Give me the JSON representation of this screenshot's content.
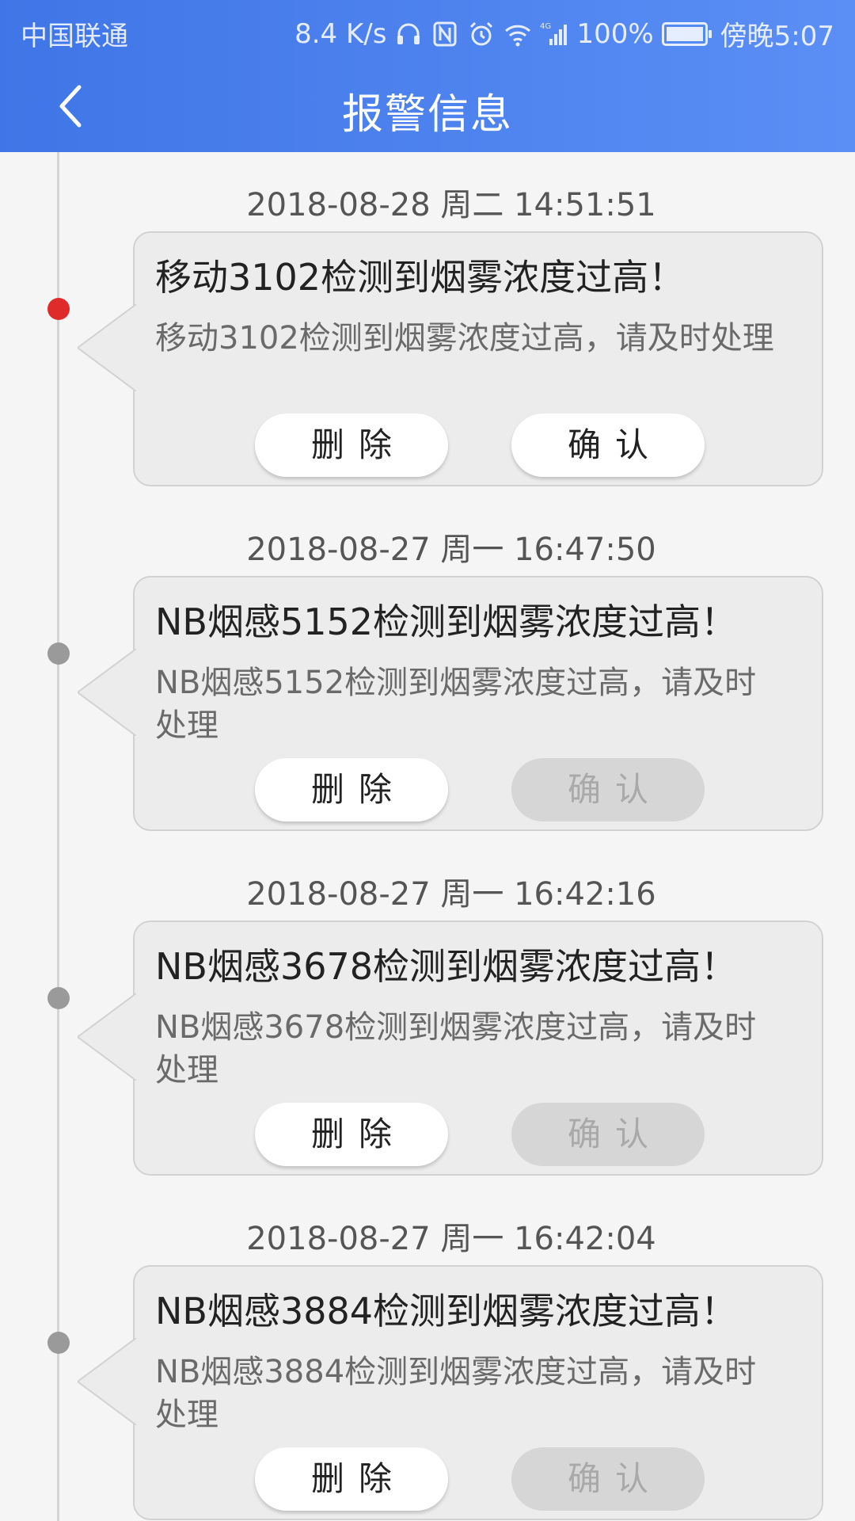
{
  "status_bar": {
    "carrier": "中国联通",
    "network_speed": "8.4 K/s",
    "network_type": "4G",
    "battery": "100%",
    "time": "傍晚5:07",
    "icons": [
      "headset-icon",
      "nfc-icon",
      "alarm-icon",
      "wifi-icon",
      "signal-icon",
      "battery-icon"
    ]
  },
  "header": {
    "title": "报警信息",
    "back_icon": "chevron-left-icon"
  },
  "colors": {
    "header_start": "#3f75e6",
    "header_end": "#5b8ff6",
    "active_dot": "#e02b2b",
    "inactive_dot": "#9a9a9a"
  },
  "alarms": [
    {
      "time": "2018-08-28 周二 14:51:51",
      "title": "移动3102检测到烟雾浓度过高！",
      "description": "移动3102检测到烟雾浓度过高，请及时处理",
      "delete_label": "删除",
      "confirm_label": "确认",
      "confirmed": false
    },
    {
      "time": "2018-08-27 周一 16:47:50",
      "title": "NB烟感5152检测到烟雾浓度过高！",
      "description": "NB烟感5152检测到烟雾浓度过高，请及时处理",
      "delete_label": "删除",
      "confirm_label": "确认",
      "confirmed": true
    },
    {
      "time": "2018-08-27 周一 16:42:16",
      "title": "NB烟感3678检测到烟雾浓度过高！",
      "description": "NB烟感3678检测到烟雾浓度过高，请及时处理",
      "delete_label": "删除",
      "confirm_label": "确认",
      "confirmed": true
    },
    {
      "time": "2018-08-27 周一 16:42:04",
      "title": "NB烟感3884检测到烟雾浓度过高！",
      "description": "NB烟感3884检测到烟雾浓度过高，请及时处理",
      "delete_label": "删除",
      "confirm_label": "确认",
      "confirmed": true
    }
  ]
}
